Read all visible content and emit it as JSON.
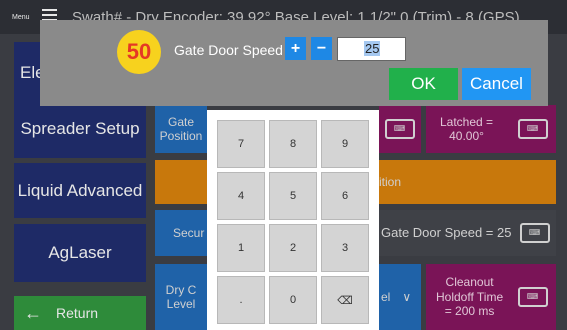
{
  "topbar": {
    "menu_label": "Menu",
    "status": "Swath# - Dry Encoder: 39.92° Base Level: 1 1/2\" 0 (Trim) - 8 (GPS)"
  },
  "nav": {
    "item1": "Ele",
    "spreader_setup": "Spreader Setup",
    "liquid_advanced": "Liquid Advanced",
    "aglaser": "AgLaser",
    "return": "Return"
  },
  "tiles": {
    "gate_position": "Gate\nPosition",
    "latched": "Latched =\n40.00°",
    "orange_partial": "ition",
    "security": "Secur",
    "gate_door_speed_status": "Gate Door Speed = 25",
    "dry_control": "Dry C\nLevel",
    "el_partial": "el",
    "cleanout": "Cleanout\nHoldoff Time\n= 200 ms",
    "keyboard_glyph": "⌨"
  },
  "dialog": {
    "badge": "50",
    "title": "Gate Door Speed",
    "plus": "+",
    "minus": "−",
    "value": "25",
    "ok": "OK",
    "cancel": "Cancel"
  },
  "keypad": {
    "keys": [
      "7",
      "8",
      "9",
      "4",
      "5",
      "6",
      "1",
      "2",
      "3",
      ".",
      "0",
      "⌫"
    ]
  },
  "colors": {
    "ok_green": "#21b04b",
    "cancel_blue": "#2196f3",
    "badge_yellow": "#f7d21e",
    "nav_navy": "#1e2a66",
    "return_green": "#2e8b3a"
  }
}
